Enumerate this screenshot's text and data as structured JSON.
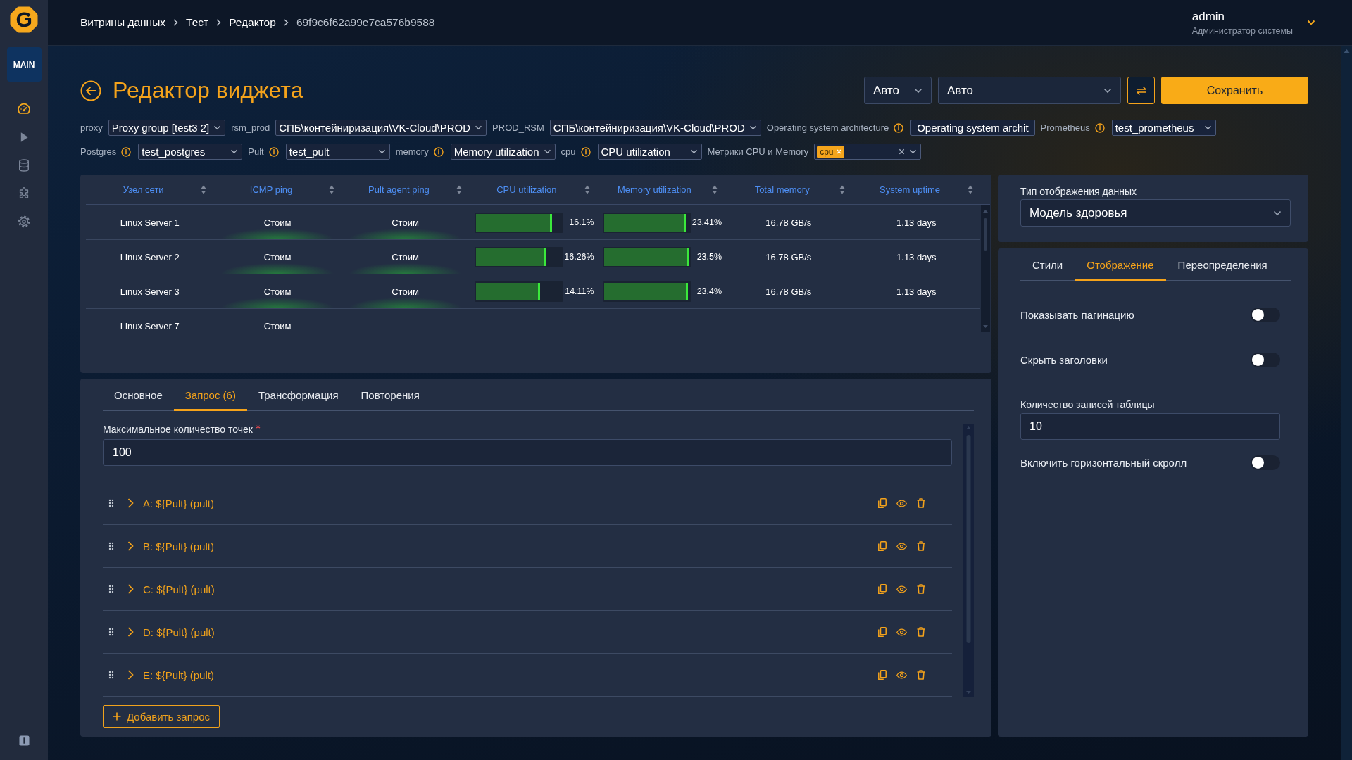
{
  "sidebar": {
    "workspace": "MAIN",
    "nav_items": [
      {
        "selected": true
      },
      {
        "selected": false
      },
      {
        "selected": false
      },
      {
        "selected": false
      },
      {
        "selected": false
      }
    ]
  },
  "breadcrumbs": [
    "Витрины данных",
    "Тест",
    "Редактор",
    "69f9c6f62a99e7ca576b9588"
  ],
  "user": {
    "name": "admin",
    "role": "Администратор системы"
  },
  "page_title": "Редактор виджета",
  "toolbar": {
    "interval": "Авто",
    "time_range": "Авто",
    "save_button": "Сохранить"
  },
  "variables": [
    [
      {
        "kind": "select",
        "label": "proxy",
        "info": false,
        "value": "Proxy group [test3 2]"
      },
      {
        "kind": "select",
        "label": "rsm_prod",
        "info": false,
        "value": "СПБ\\контейниризация\\VK-Cloud\\PROD"
      },
      {
        "kind": "select",
        "label": "PROD_RSM",
        "info": false,
        "value": "СПБ\\контейниризация\\VK-Cloud\\PROD"
      },
      {
        "kind": "text",
        "label": "Operating system architecture",
        "info": true,
        "value": "Operating system archit"
      },
      {
        "kind": "select",
        "label": "Prometheus",
        "info": true,
        "value": "test_prometheus"
      }
    ],
    [
      {
        "kind": "select",
        "label": "Postgres",
        "info": true,
        "value": "test_postgres"
      },
      {
        "kind": "select",
        "label": "Pult",
        "info": true,
        "value": "test_pult"
      },
      {
        "kind": "select",
        "label": "memory",
        "info": true,
        "value": "Memory utilization"
      },
      {
        "kind": "select",
        "label": "cpu",
        "info": true,
        "value": "CPU utilization"
      },
      {
        "kind": "multiselect",
        "label": "Метрики CPU и Memory",
        "info": false,
        "chips": [
          "cpu"
        ]
      }
    ]
  ],
  "table": {
    "columns": [
      {
        "title": "Узел сети",
        "kind": "text"
      },
      {
        "title": "ICMP ping",
        "kind": "status"
      },
      {
        "title": "Pult agent ping",
        "kind": "status"
      },
      {
        "title": "CPU utilization",
        "kind": "bar"
      },
      {
        "title": "Memory utilization",
        "kind": "bar"
      },
      {
        "title": "Total memory",
        "kind": "text"
      },
      {
        "title": "System uptime",
        "kind": "text"
      }
    ],
    "rows": [
      {
        "node": "Linux Server 1",
        "icmp_ping": "Стоим",
        "agent_ping": "Стоим",
        "cpu": {
          "level": 0.88,
          "reading": "16.1%"
        },
        "memory": {
          "level": 0.95,
          "reading": "23.41%"
        },
        "total_memory": "16.78 GB/s",
        "uptime": "1.13 days"
      },
      {
        "node": "Linux Server 2",
        "icmp_ping": "Стоим",
        "agent_ping": "Стоим",
        "cpu": {
          "level": 0.82,
          "reading": "16.26%"
        },
        "memory": {
          "level": 0.99,
          "reading": "23.5%"
        },
        "total_memory": "16.78 GB/s",
        "uptime": "1.13 days"
      },
      {
        "node": "Linux Server 3",
        "icmp_ping": "Стоим",
        "agent_ping": "Стоим",
        "cpu": {
          "level": 0.74,
          "reading": "14.11%"
        },
        "memory": {
          "level": 0.98,
          "reading": "23.4%"
        },
        "total_memory": "16.78 GB/s",
        "uptime": "1.13 days"
      },
      {
        "node": "Linux Server 7",
        "icmp_ping": "Стоим",
        "total_memory": "—",
        "uptime": "—"
      }
    ]
  },
  "editor": {
    "tabs": [
      {
        "label": "Основное",
        "selected": false
      },
      {
        "label": "Запрос (6)",
        "selected": true
      },
      {
        "label": "Трансформация",
        "selected": false
      },
      {
        "label": "Повторения",
        "selected": false
      }
    ],
    "max_points": {
      "label": "Максимальное количество точек",
      "required": true,
      "value": "100"
    },
    "queries": [
      {
        "label": "A: ${Pult} (pult)",
        "expanded": false
      },
      {
        "label": "B: ${Pult} (pult)",
        "expanded": false
      },
      {
        "label": "C: ${Pult} (pult)",
        "expanded": false
      },
      {
        "label": "D: ${Pult} (pult)",
        "expanded": false
      },
      {
        "label": "E: ${Pult} (pult)",
        "expanded": false
      }
    ],
    "add_button": "Добавить запрос"
  },
  "display_type": {
    "label": "Тип отображения данных",
    "value": "Модель здоровья"
  },
  "settings": {
    "tabs": [
      {
        "label": "Стили",
        "selected": false
      },
      {
        "label": "Отображение",
        "selected": true
      },
      {
        "label": "Переопределения",
        "selected": false
      }
    ],
    "options": [
      {
        "kind": "toggle",
        "label": "Показывать пагинацию",
        "on": false
      },
      {
        "kind": "toggle",
        "label": "Скрыть заголовки",
        "on": false
      },
      {
        "kind": "number",
        "label": "Количество записей таблицы",
        "value": "10"
      },
      {
        "kind": "toggle",
        "label": "Включить горизонтальный скролл",
        "on": false
      }
    ]
  }
}
